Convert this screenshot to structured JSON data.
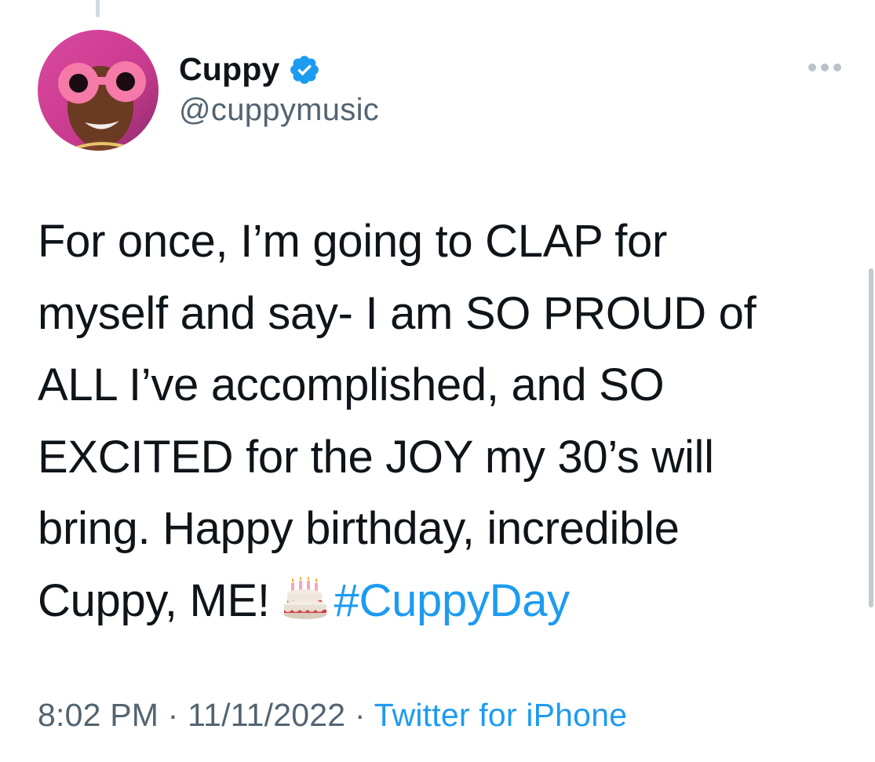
{
  "author": {
    "name": "Cuppy",
    "handle": "@cuppymusic",
    "verified": true,
    "avatar_icon": "avatar-photo"
  },
  "more_icon": "more-horizontal-icon",
  "tweet": {
    "lines": [
      "For once, I’m going to CLAP for",
      "myself and say- I am SO PROUD of",
      "ALL I’ve accomplished, and SO",
      "EXCITED for the JOY my 30’s will",
      "bring. Happy birthday, incredible"
    ],
    "last_line_prefix": "Cuppy, ME!",
    "emoji": "birthday-cake",
    "hashtag": "#CuppyDay"
  },
  "meta": {
    "time": "8:02 PM",
    "separator": " · ",
    "date": "11/11/2022",
    "source": "Twitter for iPhone"
  },
  "colors": {
    "text": "#0f1419",
    "secondary": "#536471",
    "accent": "#1d9bf0"
  }
}
